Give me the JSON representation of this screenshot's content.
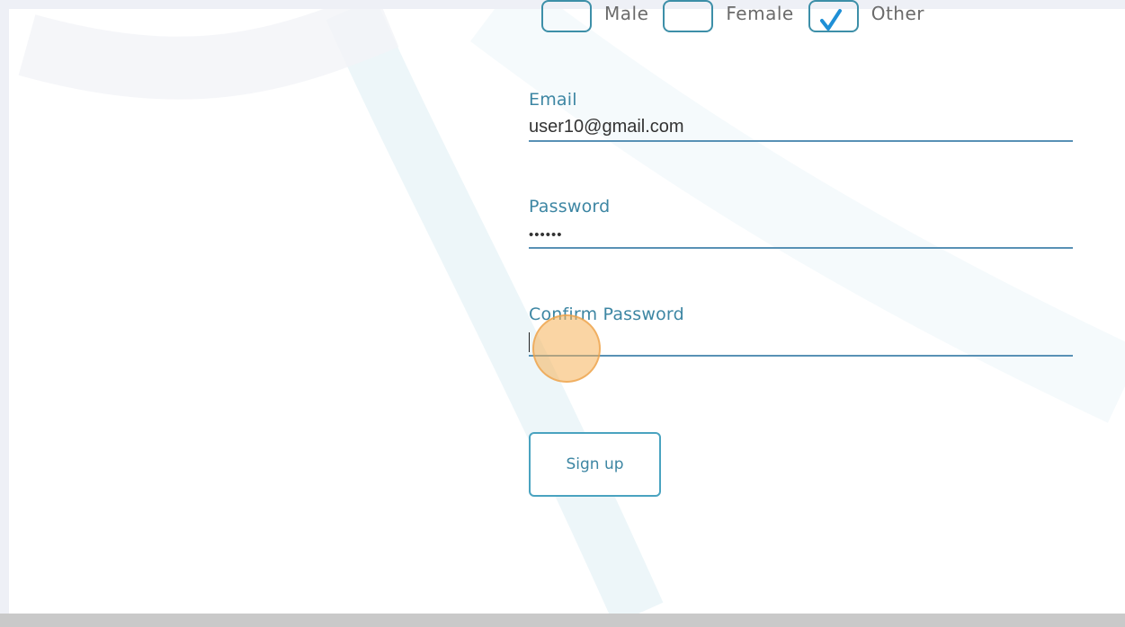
{
  "form": {
    "gender": {
      "options": [
        {
          "label": "Male",
          "checked": false
        },
        {
          "label": "Female",
          "checked": false
        },
        {
          "label": "Other",
          "checked": true
        }
      ]
    },
    "email": {
      "label": "Email",
      "value": "user10@gmail.com"
    },
    "password": {
      "label": "Password",
      "value": "••••••"
    },
    "confirm_password": {
      "label": "Confirm Password",
      "value": ""
    },
    "submit_label": "Sign up"
  },
  "colors": {
    "accent": "#3d86a3",
    "checkmark": "#1e8fd6",
    "click_marker": "#f6b25a",
    "footer": "#c9c9c9"
  }
}
